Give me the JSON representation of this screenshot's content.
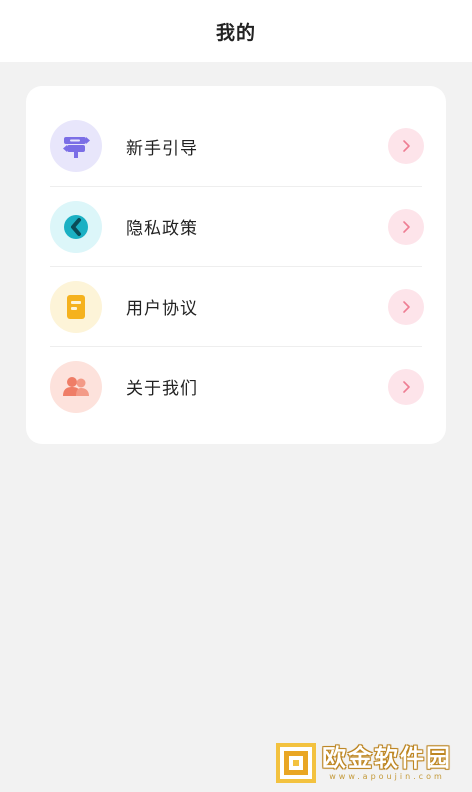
{
  "header": {
    "title": "我的"
  },
  "menu": {
    "items": [
      {
        "label": "新手引导",
        "icon": "signpost-icon",
        "icon_bg": "#e8e6fb",
        "icon_color": "#7b6ee6"
      },
      {
        "label": "隐私政策",
        "icon": "shield-icon",
        "icon_bg": "#dcf6f9",
        "icon_color": "#1bb0c3"
      },
      {
        "label": "用户协议",
        "icon": "document-icon",
        "icon_bg": "#fdf4d8",
        "icon_color": "#f5b21e"
      },
      {
        "label": "关于我们",
        "icon": "users-icon",
        "icon_bg": "#fde2dc",
        "icon_color": "#ef7d67"
      }
    ]
  },
  "colors": {
    "background": "#f2f2f2",
    "card": "#ffffff",
    "chevron_bg": "#fde4ea",
    "chevron_color": "#ee7d93"
  },
  "watermark": {
    "text": "欧金软件园",
    "url": "www.apoujin.com"
  }
}
